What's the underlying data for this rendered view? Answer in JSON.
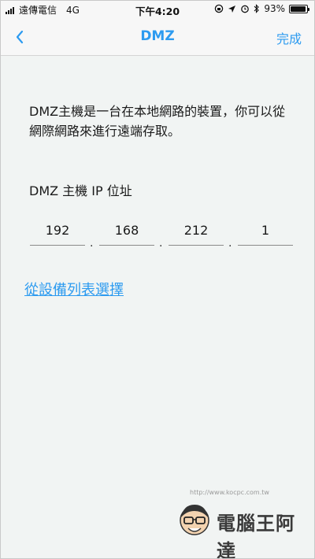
{
  "status_bar": {
    "carrier": "遠傳電信",
    "network": "4G",
    "time": "下午4:20",
    "battery": "93%",
    "battery_level": 0.93
  },
  "nav": {
    "back_icon": "chevron-left-icon",
    "title": "DMZ",
    "done_label": "完成"
  },
  "description": "DMZ主機是一台在本地網路的裝置，你可以從網際網路來進行遠端存取。",
  "ip_section": {
    "label": "DMZ 主機 IP 位址",
    "octets": [
      "192",
      "168",
      "212",
      "1"
    ],
    "separator": "."
  },
  "pick_from_list_label": "從設備列表選擇",
  "watermark": {
    "url": "http://www.kocpc.com.tw",
    "brand": "電腦王阿達"
  },
  "colors": {
    "accent": "#2d9bf0",
    "background": "#f1f4f3",
    "bar": "#f7f7f7"
  }
}
